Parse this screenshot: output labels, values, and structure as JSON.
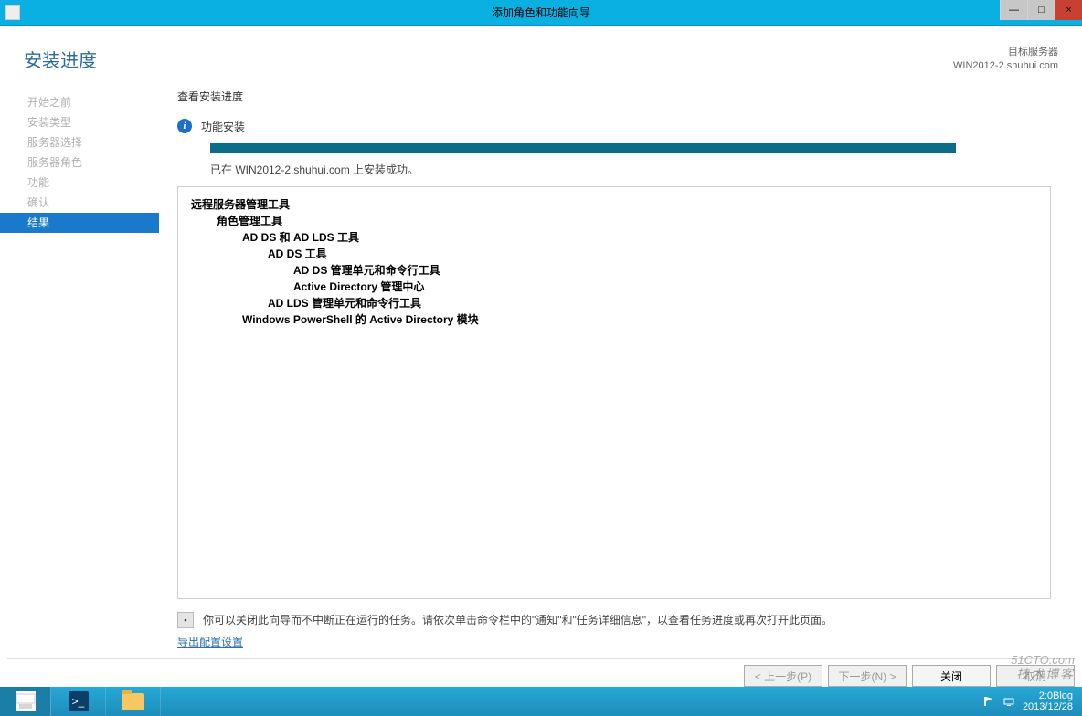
{
  "window": {
    "title": "添加角色和功能向导",
    "minimize": "—",
    "maximize": "□",
    "close": "×"
  },
  "header": {
    "title": "安装进度",
    "dest_label": "目标服务器",
    "dest_value": "WIN2012-2.shuhui.com"
  },
  "sidebar": {
    "items": [
      {
        "label": "开始之前"
      },
      {
        "label": "安装类型"
      },
      {
        "label": "服务器选择"
      },
      {
        "label": "服务器角色"
      },
      {
        "label": "功能"
      },
      {
        "label": "确认"
      },
      {
        "label": "结果"
      }
    ]
  },
  "content": {
    "view_progress": "查看安装进度",
    "feature_install": "功能安装",
    "success_msg": "已在 WIN2012-2.shuhui.com 上安装成功。",
    "tree": {
      "l1": "远程服务器管理工具",
      "l2": "角色管理工具",
      "l3a": "AD DS 和 AD LDS 工具",
      "l4a": "AD DS 工具",
      "l5a": "AD DS 管理单元和命令行工具",
      "l5b": "Active Directory 管理中心",
      "l4b": "AD LDS 管理单元和命令行工具",
      "l3b": "Windows PowerShell 的 Active Directory 模块"
    },
    "note": "你可以关闭此向导而不中断正在运行的任务。请依次单击命令栏中的\"通知\"和\"任务详细信息\"，以查看任务进度或再次打开此页面。",
    "export_link": "导出配置设置"
  },
  "footer": {
    "prev": "< 上一步(P)",
    "next": "下一步(N) >",
    "close": "关闭",
    "cancel": "取消"
  },
  "taskbar": {
    "ps": ">_",
    "clock_time": "2:0Blog",
    "clock_date": "2013/12/28"
  },
  "watermark": {
    "line1": "51CTO.com",
    "line2": "技术博客"
  }
}
